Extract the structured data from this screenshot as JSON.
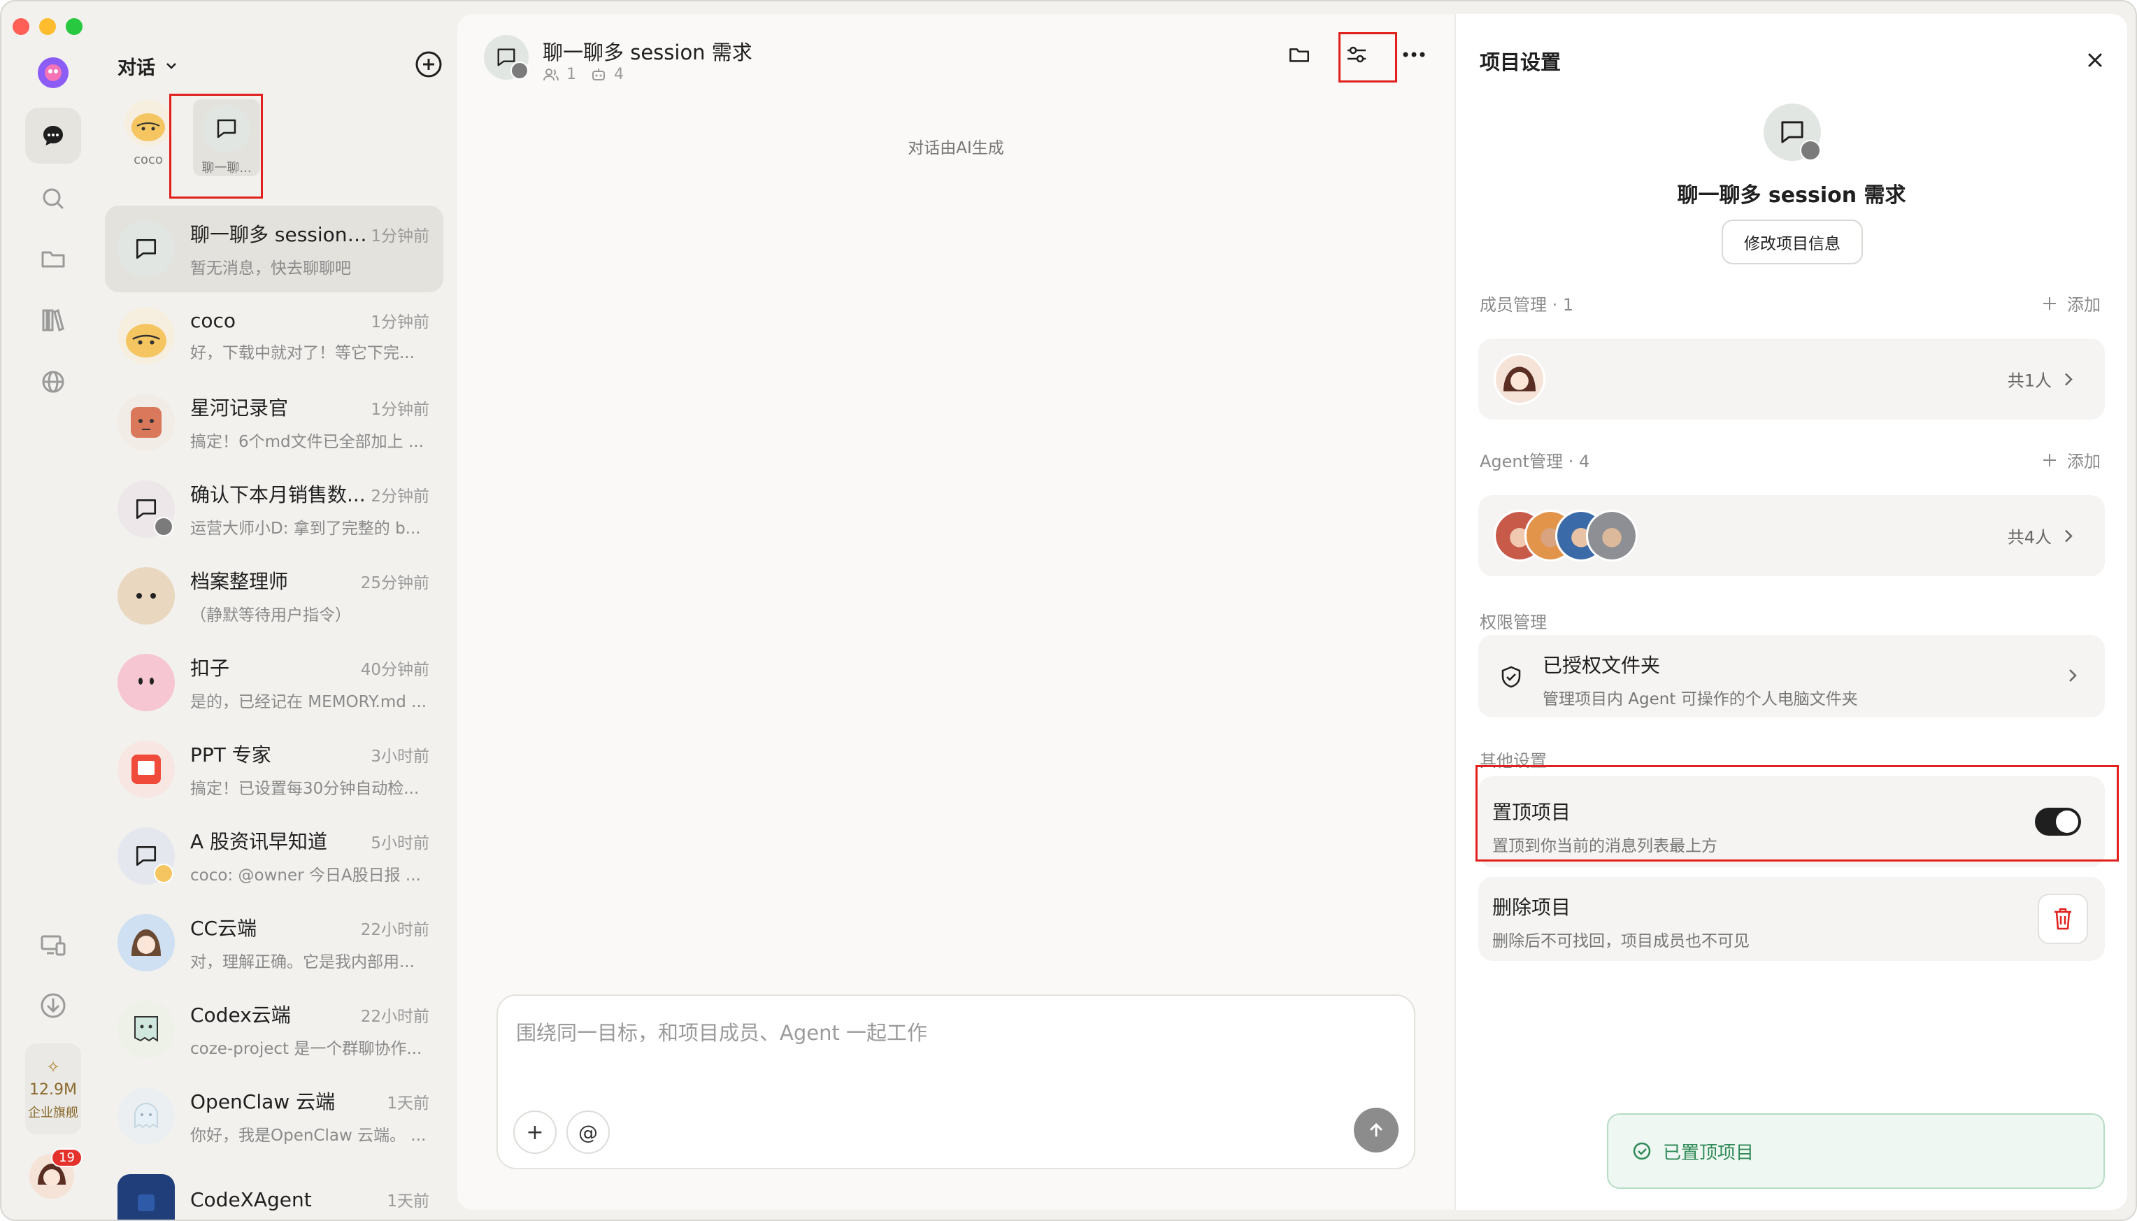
{
  "app": {
    "brand_color": "#8b5cf6",
    "traffic": [
      "#ff5f57",
      "#febc2e",
      "#28c840"
    ]
  },
  "rail": {
    "items": [
      "chat-icon",
      "search-icon",
      "folder-icon",
      "library-icon",
      "globe-icon"
    ],
    "bottom": {
      "devices": "devices-icon",
      "download": "download-icon",
      "storage_value": "12.9M",
      "plan_label": "企业旗舰",
      "badge": "19"
    }
  },
  "conv": {
    "title": "对话",
    "pinned": [
      {
        "label": "coco"
      },
      {
        "label": "聊一聊..."
      }
    ],
    "items": [
      {
        "name": "聊一聊多 session ...",
        "time": "1分钟前",
        "preview": "暂无消息，快去聊聊吧"
      },
      {
        "name": "coco",
        "time": "1分钟前",
        "preview": "好，下载中就对了！等它下完..."
      },
      {
        "name": "星河记录官",
        "time": "1分钟前",
        "preview": "搞定！6个md文件已全部加上 ..."
      },
      {
        "name": "确认下本月销售数...",
        "time": "2分钟前",
        "preview": "运营大师小D: 拿到了完整的 b..."
      },
      {
        "name": "档案整理师",
        "time": "25分钟前",
        "preview": "（静默等待用户指令）"
      },
      {
        "name": "扣子",
        "time": "40分钟前",
        "preview": "是的，已经记在 MEMORY.md ..."
      },
      {
        "name": "PPT 专家",
        "time": "3小时前",
        "preview": "搞定！已设置每30分钟自动检..."
      },
      {
        "name": "A 股资讯早知道",
        "time": "5小时前",
        "preview": "coco: @owner 今日A股日报 ..."
      },
      {
        "name": "CC云端",
        "time": "22小时前",
        "preview": "对，理解正确。它是我内部用..."
      },
      {
        "name": "Codex云端",
        "time": "22小时前",
        "preview": "coze-project 是一个群聊协作..."
      },
      {
        "name": "OpenClaw 云端",
        "time": "1天前",
        "preview": "你好，我是OpenClaw 云端。 ..."
      },
      {
        "name": "CodeXAgent",
        "time": "1天前",
        "preview": ""
      }
    ]
  },
  "chat": {
    "title": "聊一聊多 session 需求",
    "members": "1",
    "agents": "4",
    "ai_note": "对话由AI生成",
    "composer_placeholder": "围绕同一目标，和项目成员、Agent 一起工作",
    "plus": "+",
    "at": "@"
  },
  "settings": {
    "title": "项目设置",
    "project_name": "聊一聊多 session 需求",
    "edit_label": "修改项目信息",
    "member_label": "成员管理",
    "member_count": "1",
    "add_label": "添加",
    "member_total": "共1人",
    "agent_label": "Agent管理",
    "agent_count": "4",
    "agent_total": "共4人",
    "perm_label": "权限管理",
    "auth_title": "已授权文件夹",
    "auth_desc": "管理项目内 Agent 可操作的个人电脑文件夹",
    "other_label": "其他设置",
    "pin_title": "置顶项目",
    "pin_desc": "置顶到你当前的消息列表最上方",
    "pin_on": true,
    "del_title": "删除项目",
    "del_desc": "删除后不可找回，项目成员也不可见",
    "dot": "·"
  },
  "toast": {
    "text": "已置顶项目"
  }
}
